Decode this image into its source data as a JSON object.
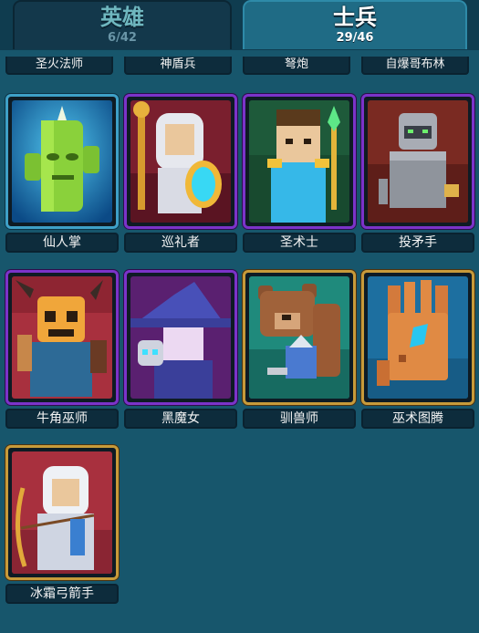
{
  "tabs": {
    "heroes": {
      "label": "英雄",
      "count": "6/42"
    },
    "troops": {
      "label": "士兵",
      "count": "29/46"
    }
  },
  "partial_row": [
    "圣火法师",
    "神盾兵",
    "弩炮",
    "自爆哥布林"
  ],
  "cards": [
    {
      "name": "仙人掌",
      "rarity": "rare",
      "icon": "cactus-icon"
    },
    {
      "name": "巡礼者",
      "rarity": "epic",
      "icon": "pilgrim-icon"
    },
    {
      "name": "圣术士",
      "rarity": "epic",
      "icon": "sorcerer-icon"
    },
    {
      "name": "投矛手",
      "rarity": "epic",
      "icon": "spear-thrower-icon"
    },
    {
      "name": "牛角巫师",
      "rarity": "epic",
      "icon": "horned-shaman-icon"
    },
    {
      "name": "黑魔女",
      "rarity": "epic",
      "icon": "dark-witch-icon"
    },
    {
      "name": "驯兽师",
      "rarity": "legendary",
      "icon": "beast-tamer-icon"
    },
    {
      "name": "巫术图腾",
      "rarity": "legendary",
      "icon": "voodoo-totem-icon"
    },
    {
      "name": "冰霜弓箭手",
      "rarity": "legendary",
      "icon": "frost-archer-icon"
    }
  ],
  "colors": {
    "background": "#17566c",
    "rare_border": "#3ea0c7",
    "epic_border": "#7b33c9",
    "legendary_border": "#c79a3a"
  }
}
